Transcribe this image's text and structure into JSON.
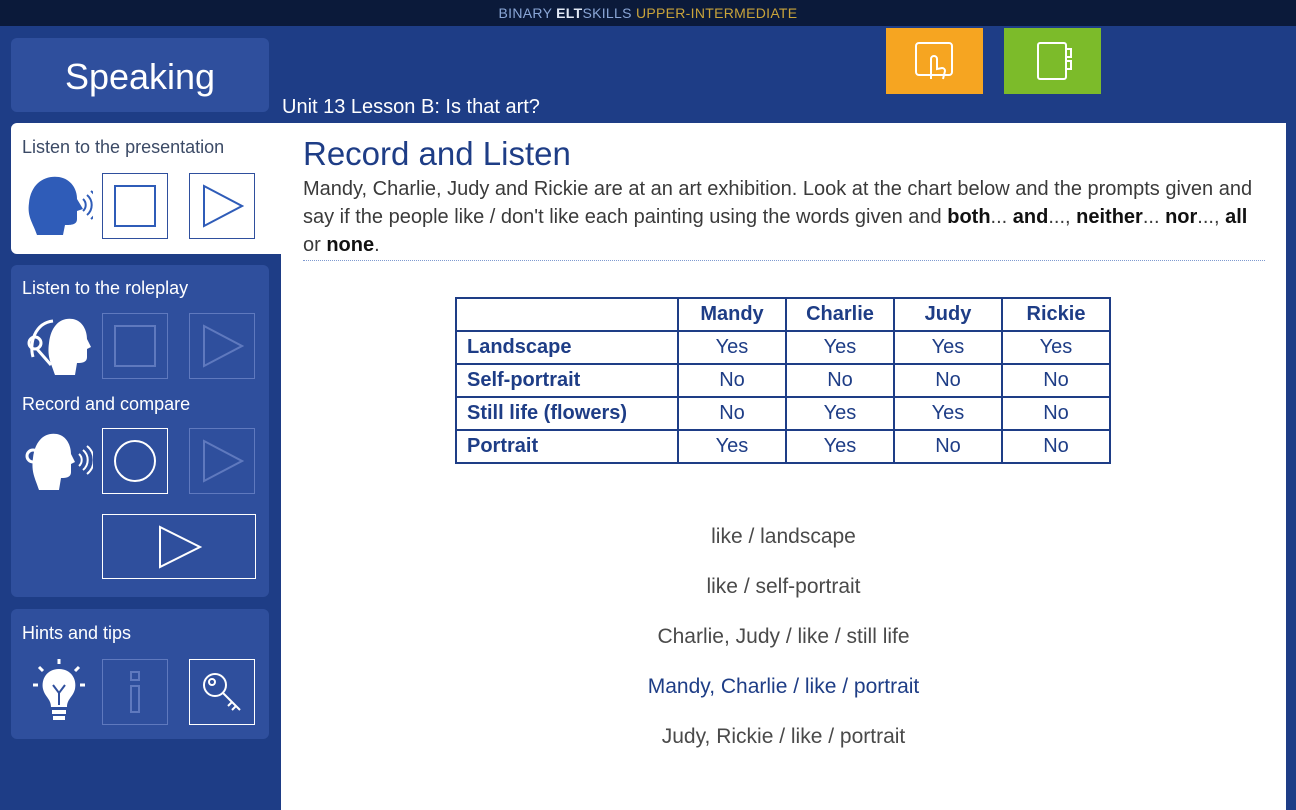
{
  "header": {
    "brand_part1": "BINARY ",
    "brand_part2": "ELT",
    "brand_part3": "SKILLS ",
    "brand_part4": "UPPER-INTERMEDIATE"
  },
  "section_title": "Speaking",
  "breadcrumb": "Unit 13 Lesson B: Is that art?",
  "top_buttons": [
    {
      "icon": "touch-icon",
      "color": "#f6a521"
    },
    {
      "icon": "notebook-icon",
      "color": "#7cbb2a"
    }
  ],
  "sidebar": {
    "presentation_label": "Listen to the presentation",
    "roleplay_label": "Listen to the roleplay",
    "record_label": "Record and compare",
    "hints_label": "Hints and tips"
  },
  "main": {
    "title": "Record and Listen",
    "instruction_text": "Mandy, Charlie, Judy and Rickie are at an art exhibition. Look at the chart below and the prompts given and say if the people like / don't like each painting using the words given and ",
    "kw_both": "both",
    "dots1": "... ",
    "kw_and": "and",
    "dots2": "..., ",
    "kw_neither": "neither",
    "dots3": "... ",
    "kw_nor": "nor",
    "dots4": "..., ",
    "kw_all": "all",
    "or_word": " or ",
    "kw_none": "none",
    "end_dot": ".",
    "table": {
      "headers": [
        "",
        "Mandy",
        "Charlie",
        "Judy",
        "Rickie"
      ],
      "rows": [
        {
          "label": "Landscape",
          "values": [
            "Yes",
            "Yes",
            "Yes",
            "Yes"
          ]
        },
        {
          "label": "Self-portrait",
          "values": [
            "No",
            "No",
            "No",
            "No"
          ]
        },
        {
          "label": "Still life (flowers)",
          "values": [
            "No",
            "Yes",
            "Yes",
            "No"
          ]
        },
        {
          "label": "Portrait",
          "values": [
            "Yes",
            "Yes",
            "No",
            "No"
          ]
        }
      ]
    },
    "prompts": [
      "like / landscape",
      "like / self-portrait",
      "Charlie, Judy / like / still life",
      "Mandy, Charlie / like / portrait",
      "Judy, Rickie / like / portrait"
    ],
    "selected_prompt_index": 3
  }
}
